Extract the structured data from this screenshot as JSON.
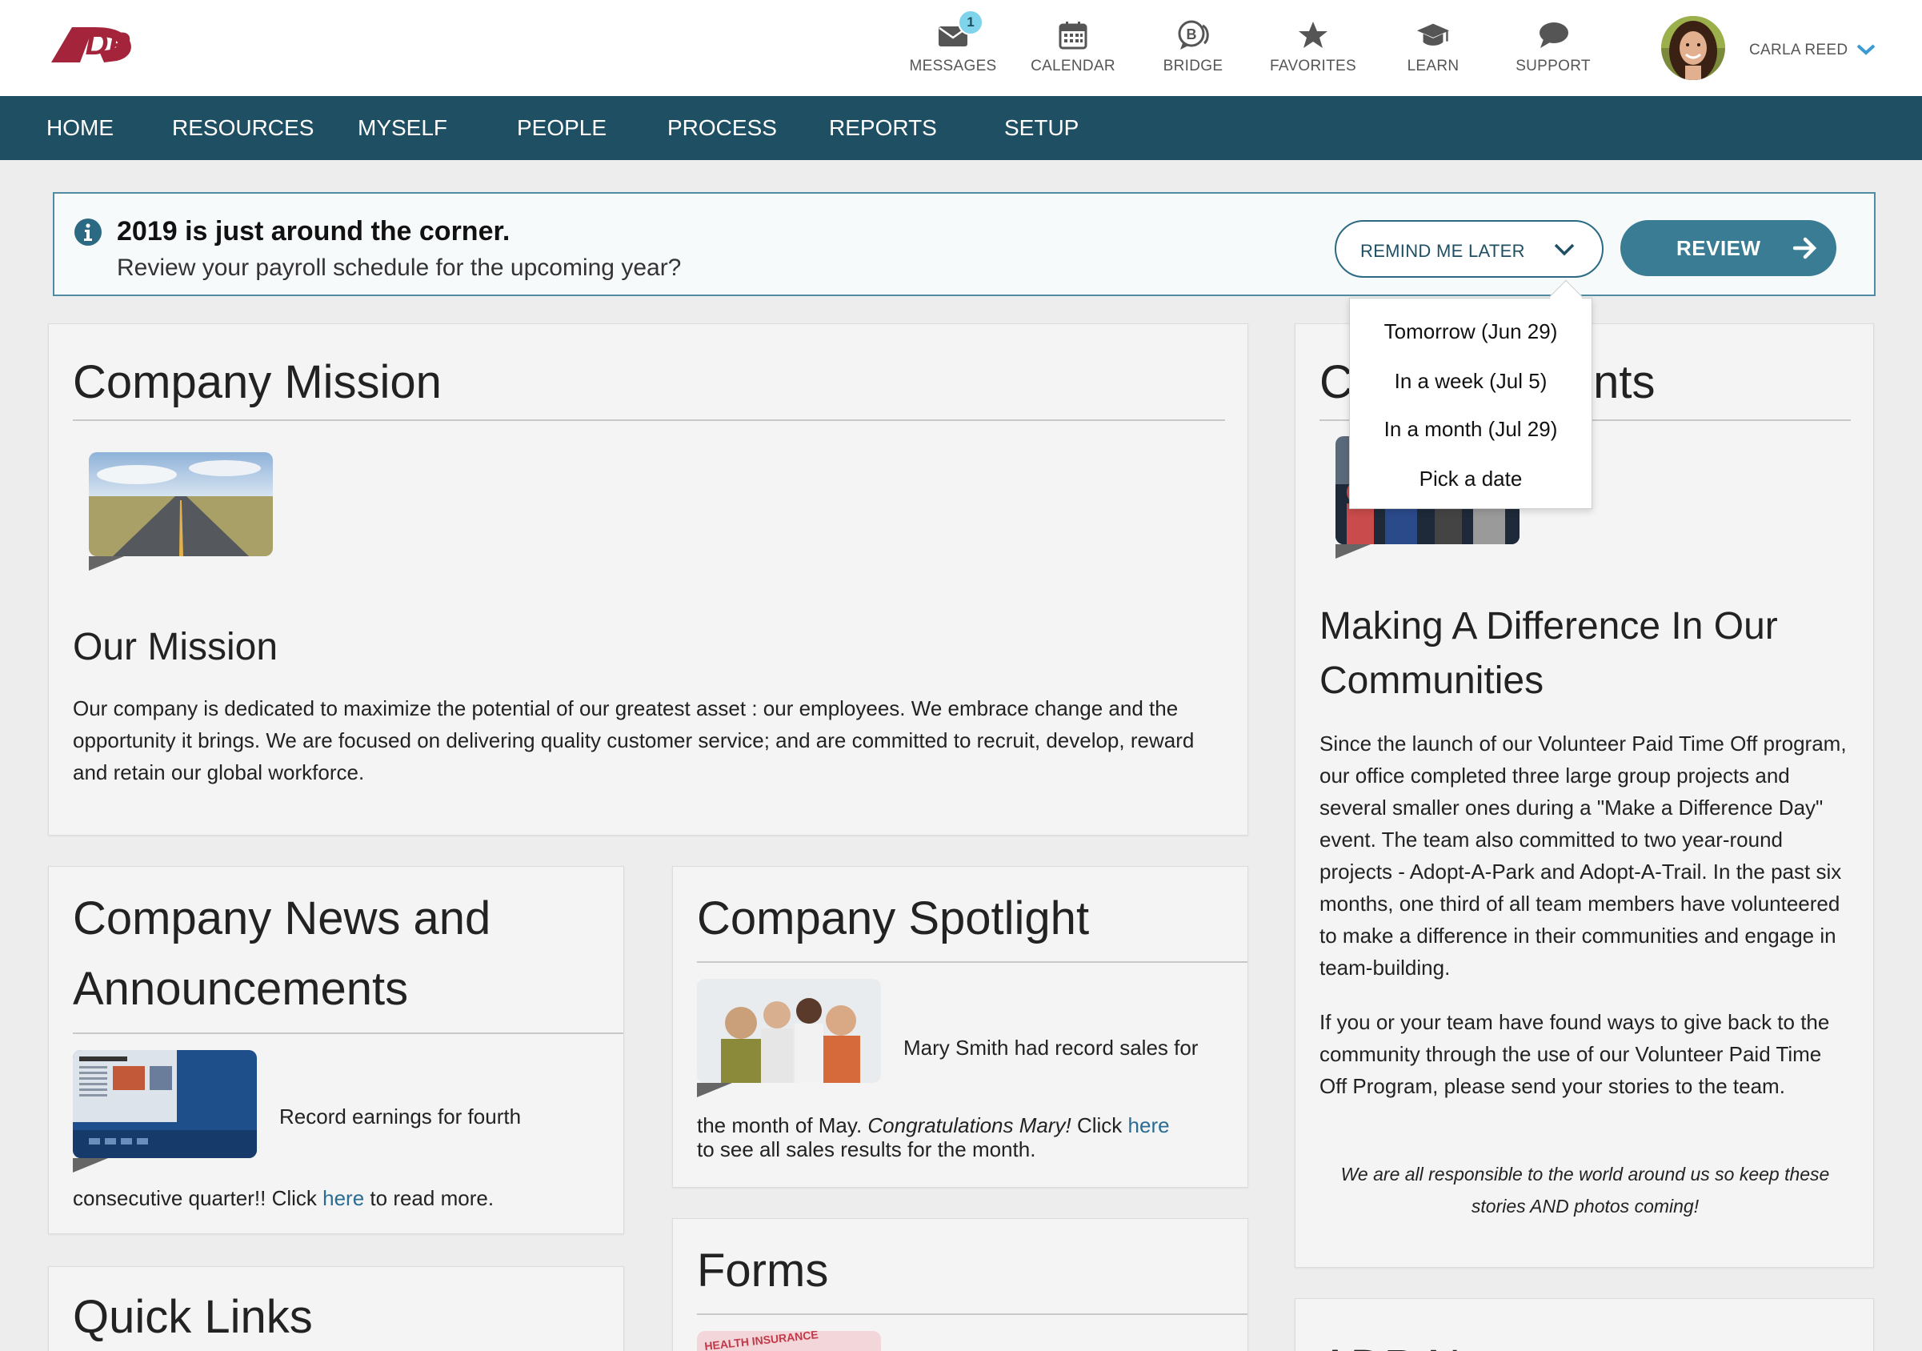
{
  "header": {
    "logo_text": "ADP",
    "nav": [
      {
        "label": "MESSAGES",
        "badge": "1"
      },
      {
        "label": "CALENDAR"
      },
      {
        "label": "BRIDGE"
      },
      {
        "label": "FAVORITES"
      },
      {
        "label": "LEARN"
      },
      {
        "label": "SUPPORT"
      }
    ],
    "user_name": "CARLA REED"
  },
  "main_nav": [
    "HOME",
    "RESOURCES",
    "MYSELF",
    "PEOPLE",
    "PROCESS",
    "REPORTS",
    "SETUP"
  ],
  "banner": {
    "title": "2019 is just around the corner.",
    "subtitle": "Review your payroll schedule for the upcoming year?",
    "remind_label": "REMIND ME LATER",
    "review_label": "REVIEW"
  },
  "remind_options": [
    "Tomorrow (Jun 29)",
    "In a week (Jul 5)",
    "In a month (Jul 29)",
    "Pick a date"
  ],
  "mission": {
    "title": "Company Mission",
    "subtitle": "Our Mission",
    "body": "Our company is dedicated to maximize the potential of our greatest asset : our employees. We embrace change and the opportunity it brings. We are focused on delivering quality customer service; and are committed to recruit, develop, reward and retain our global workforce."
  },
  "events": {
    "title_start": "C",
    "title_end": "ents",
    "subtitle": "Making A Difference In Our Communities",
    "para1": "Since the launch of our Volunteer Paid Time Off program, our office completed three large group projects and several smaller ones during a \"Make a Difference Day\" event.  The team also committed to two year-round projects - Adopt-A-Park and Adopt-A-Trail.  In the past six months, one third of all team members have volunteered to make a difference in their communities and engage in team-building.",
    "para2": "If you or your team have found ways to give back to the community through the use of our Volunteer Paid Time Off Program, please send your stories to the team.",
    "quote": "We are all responsible to the world around us so keep these stories AND photos coming!"
  },
  "news": {
    "title_line1": "Company News and",
    "title_line2": "Announcements",
    "text_beside": "Record earnings for fourth",
    "text_pre": "consecutive quarter!! Click ",
    "link": "here",
    "text_post": " to read more."
  },
  "spotlight": {
    "title": "Company Spotlight",
    "text_beside": "Mary Smith had record sales for",
    "text_pre": "the month of May. ",
    "text_italic": "Congratulations Mary!",
    "text_mid": "  Click ",
    "link": "here",
    "text_post": "to see all sales results for the month."
  },
  "quick_links": {
    "title": "Quick Links"
  },
  "forms": {
    "title": "Forms",
    "thumb_text": "HEALTH INSURANCE"
  },
  "adp_news": {
    "title": "ADP N"
  },
  "colors": {
    "nav_bg": "#1f4f63",
    "brand_red": "#a4243b",
    "button_teal": "#3a7c94",
    "link": "#2a6d93",
    "badge": "#7fd3ea"
  }
}
